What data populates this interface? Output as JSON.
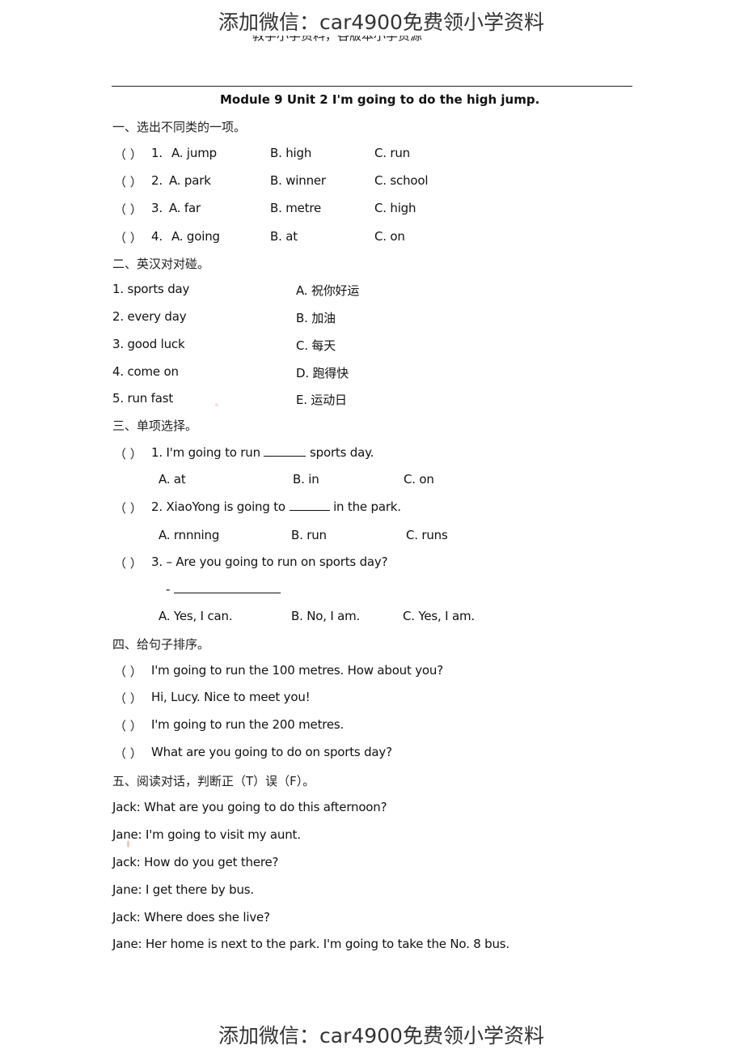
{
  "watermark": {
    "top": "添加微信：car4900免费领小学资料",
    "bottom": "添加微信：car4900免费领小学资料"
  },
  "clipped_header_line": "教学小学资料，各版本小学资源",
  "title": "Module 9 Unit 2 I'm going to do the high jump.",
  "section1": {
    "heading": "一、选出不同类的一项。",
    "items": [
      {
        "paren": "（    ）",
        "num": "1.",
        "a": "A. jump",
        "b": "B. high",
        "c": "C. run"
      },
      {
        "paren": "（    ）",
        "num": "2.",
        "a": "A. park",
        "b": "B. winner",
        "c": "C. school"
      },
      {
        "paren": "（    ）",
        "num": "3.",
        "a": "A. far",
        "b": "B. metre",
        "c": "C. high"
      },
      {
        "paren": "（    ）",
        "num": "4.",
        "a": "A. going",
        "b": "B. at",
        "c": "C. on"
      }
    ]
  },
  "section2": {
    "heading": "二、英汉对对碰。",
    "left": [
      "1. sports day",
      "2. every day",
      "3. good luck",
      "4. come on",
      "5. run fast"
    ],
    "right": [
      "A.  祝你好运",
      "B.  加油",
      "C.  每天",
      "D.  跑得快",
      "E.  运动日"
    ]
  },
  "section3": {
    "heading": "三、单项选择。",
    "questions": [
      {
        "paren": "（    ）",
        "pre": "1. I'm going to run",
        "post": "sports day.",
        "options": [
          "A. at",
          "B. in",
          "C. on"
        ]
      },
      {
        "paren": "（    ）",
        "pre": "2. XiaoYong is going to",
        "post": "in the park.",
        "options": [
          "A. rnnning",
          "B. run",
          "C. runs"
        ]
      },
      {
        "paren": "（    ）",
        "pre": "3. – Are you going to run on sports day?",
        "answer_dash": "-",
        "options": [
          "A. Yes, I can.",
          "B. No, I am.",
          "C. Yes, I am."
        ]
      }
    ]
  },
  "section4": {
    "heading": "四、给句子排序。",
    "items": [
      {
        "paren": "（    ）",
        "text": "I'm going to run the 100 metres. How about you?"
      },
      {
        "paren": "（    ）",
        "text": "Hi, Lucy. Nice to meet you!"
      },
      {
        "paren": "（    ）",
        "text": "I'm going to run the 200 metres."
      },
      {
        "paren": "（    ）",
        "text": "What are you going to do on sports day?"
      }
    ]
  },
  "section5": {
    "heading": "五、阅读对话，判断正（T）误（F）。",
    "dialogue": [
      "Jack: What are you going to do this afternoon?",
      "Jane: I'm going to visit my aunt.",
      "Jack: How do you get there?",
      "Jane: I get there by bus.",
      "Jack: Where does she live?",
      "Jane: Her home is next to the park. I'm going to take the No. 8 bus."
    ]
  }
}
